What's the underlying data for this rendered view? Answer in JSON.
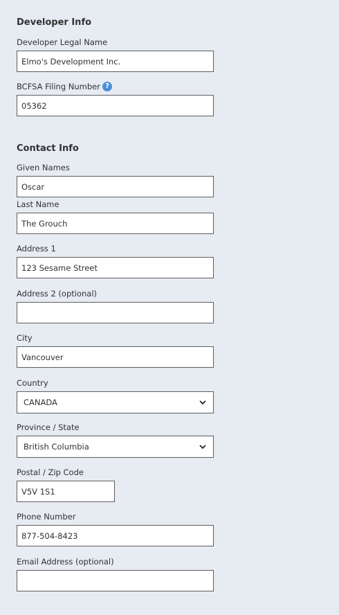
{
  "developer_info": {
    "heading": "Developer Info",
    "legal_name_label": "Developer Legal Name",
    "legal_name_value": "Elmo's Development Inc.",
    "filing_number_label": "BCFSA Filing Number",
    "filing_number_value": "05362",
    "help_glyph": "?"
  },
  "contact_info": {
    "heading": "Contact Info",
    "given_names_label": "Given Names",
    "given_names_value": "Oscar",
    "last_name_label": "Last Name",
    "last_name_value": "The Grouch",
    "address1_label": "Address 1",
    "address1_value": "123 Sesame Street",
    "address2_label": "Address 2 (optional)",
    "address2_value": "",
    "city_label": "City",
    "city_value": "Vancouver",
    "country_label": "Country",
    "country_value": "CANADA",
    "province_label": "Province / State",
    "province_value": "British Columbia",
    "postal_label": "Postal / Zip Code",
    "postal_value": "V5V 1S1",
    "phone_label": "Phone Number",
    "phone_value": "877-504-8423",
    "email_label": "Email Address (optional)",
    "email_value": ""
  },
  "colors": {
    "background": "#e7ebf2",
    "field_border": "#5d5d5d",
    "help_icon": "#4a90d9"
  },
  "icons": {
    "help": "help-icon",
    "select_arrow": "chevron-down-icon"
  }
}
